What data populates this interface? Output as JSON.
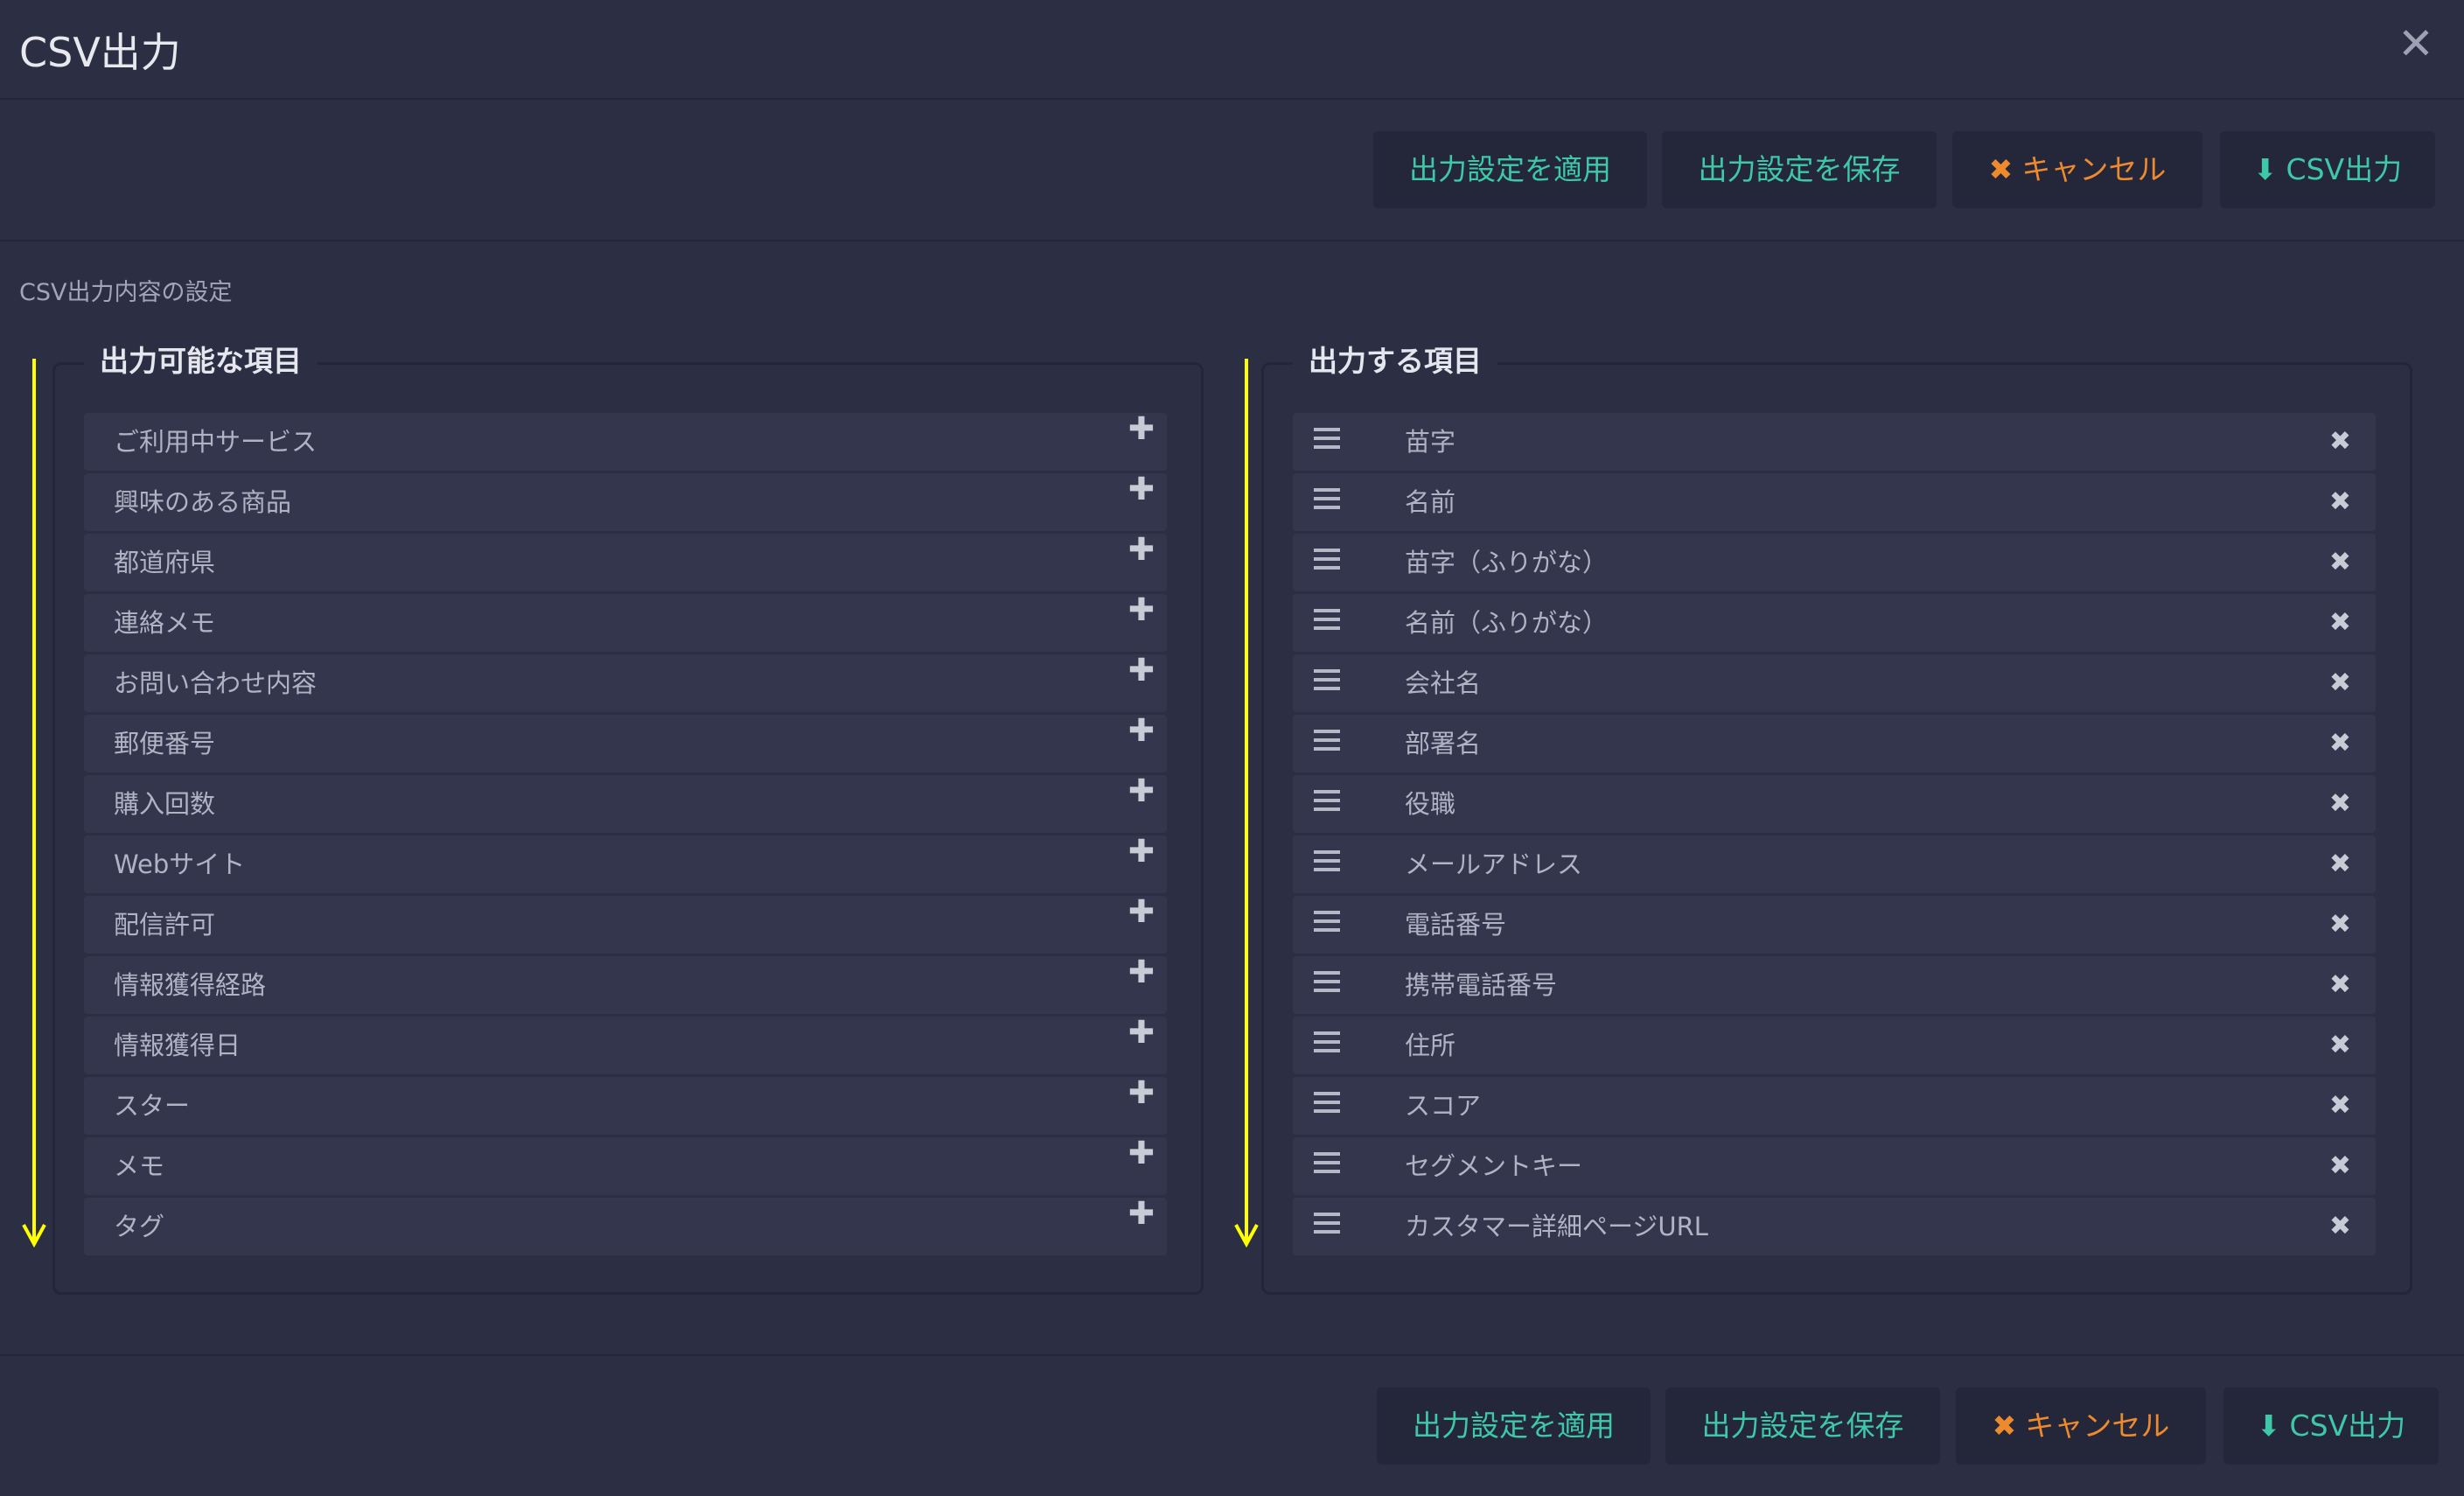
{
  "window": {
    "title": "CSV出力",
    "close_icon": "close-icon"
  },
  "toolbar": {
    "apply_label": "出力設定を適用",
    "save_label": "出力設定を保存",
    "cancel_label": "キャンセル",
    "export_label": "CSV出力",
    "cancel_icon": "✖",
    "export_icon": "⬇"
  },
  "section": {
    "label": "CSV出力内容の設定"
  },
  "available": {
    "legend": "出力可能な項目",
    "items": [
      "ご利用中サービス",
      "興味のある商品",
      "都道府県",
      "連絡メモ",
      "お問い合わせ内容",
      "郵便番号",
      "購入回数",
      "Webサイト",
      "配信許可",
      "情報獲得経路",
      "情報獲得日",
      "スター",
      "メモ",
      "タグ"
    ],
    "add_icon": "✚"
  },
  "selected": {
    "legend": "出力する項目",
    "items": [
      "苗字",
      "名前",
      "苗字（ふりがな）",
      "名前（ふりがな）",
      "会社名",
      "部署名",
      "役職",
      "メールアドレス",
      "電話番号",
      "携帯電話番号",
      "住所",
      "スコア",
      "セグメントキー",
      "カスタマー詳細ページURL"
    ],
    "remove_icon": "✖"
  },
  "colors": {
    "accent_green": "#3ec8a8",
    "accent_orange": "#ee8a2e",
    "annotation_arrow": "#ffff00",
    "background": "#2c2f44"
  }
}
